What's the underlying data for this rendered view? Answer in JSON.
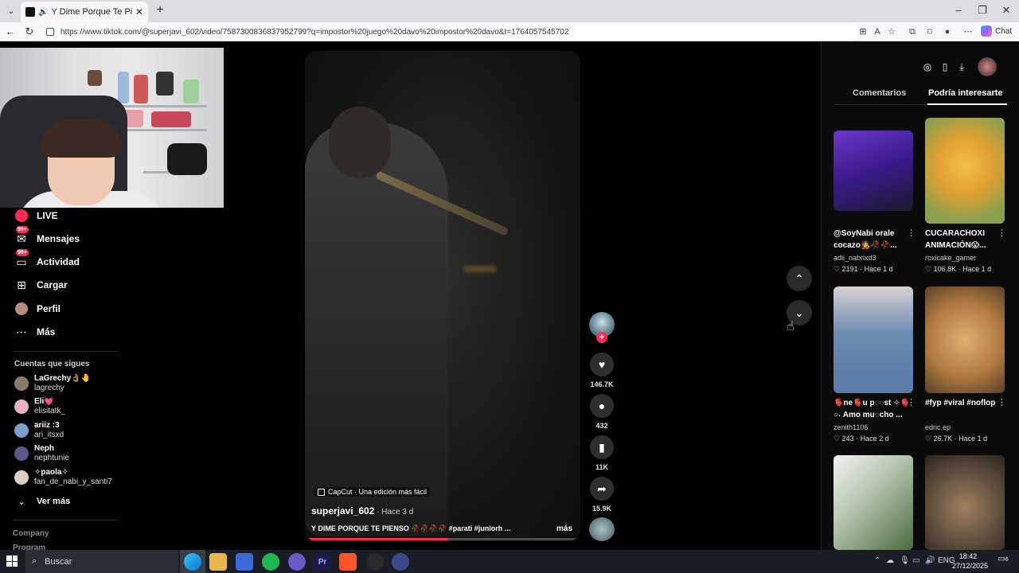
{
  "browser": {
    "tab_title": "Y Dime Porque Te Pienso: Jun",
    "url": "https://www.tiktok.com/@superjavi_602/video/7587300836837952799?q=impostor%20juego%20davo%20impostor%20davo&t=1764057545702",
    "copilot_label": "Chat"
  },
  "sidebar": {
    "nav": [
      {
        "label": "LIVE",
        "icon": "live-icon"
      },
      {
        "label": "Mensajes",
        "icon": "messages-icon",
        "badge": "99+"
      },
      {
        "label": "Actividad",
        "icon": "activity-icon",
        "badge": "99+"
      },
      {
        "label": "Cargar",
        "icon": "upload-icon"
      },
      {
        "label": "Perfil",
        "icon": "profile-icon"
      },
      {
        "label": "Más",
        "icon": "more-icon"
      }
    ],
    "following_title": "Cuentas que sigues",
    "following": [
      {
        "name": "LaGrechy👌🏽🤚",
        "handle": "lagrechy"
      },
      {
        "name": "Eli💓",
        "handle": "elisitatk_"
      },
      {
        "name": "ariiz :3",
        "handle": "ari_itsxd"
      },
      {
        "name": "Neph",
        "handle": "nephtunie"
      },
      {
        "name": "✧paola✧",
        "handle": "fan_de_nabi_y_santi7"
      }
    ],
    "see_more": "Ver más",
    "footer": [
      "Company",
      "Program"
    ]
  },
  "video": {
    "capcut": "CapCut · Una edición más fácil",
    "author": "superjavi_602",
    "time": " · Hace 3 d",
    "description": "Y DIME PORQUE TE PIENSO 🥀🥀🥀🥀 #parati #juniorh ...",
    "more": "más",
    "progress": 0.52
  },
  "actions": {
    "likes": "146.7K",
    "comments": "432",
    "saves": "11K",
    "shares": "15.9K"
  },
  "right_panel": {
    "tabs": [
      "Comentarios",
      "Podría interesarte"
    ],
    "cards": [
      {
        "title": "@SoyNabi orale cocazo🧑‍🎤🥀🥀...",
        "author": "adii_nabrixd3",
        "likes": "2191",
        "time": "Hace 1 d"
      },
      {
        "title": "CUCARACHOXI ANIMACIÓN😱...",
        "author": "roxicake_gamer",
        "likes": "106.8K",
        "time": "Hace 1 d"
      },
      {
        "title": "🫀ne🫀u p◌◌st ✧🫀 ○˖ Amo mu◌cho ...",
        "author": "zenith1106",
        "likes": "243",
        "time": "Hace 2 d"
      },
      {
        "title": "#fyp #viral #noflop",
        "author": "edric.ep",
        "likes": "26.7K",
        "time": "Hace 1 d"
      }
    ]
  },
  "taskbar": {
    "search_placeholder": "Buscar",
    "lang": "ENG",
    "time": "18:42",
    "date": "27/12/2025",
    "notifications": "6"
  }
}
